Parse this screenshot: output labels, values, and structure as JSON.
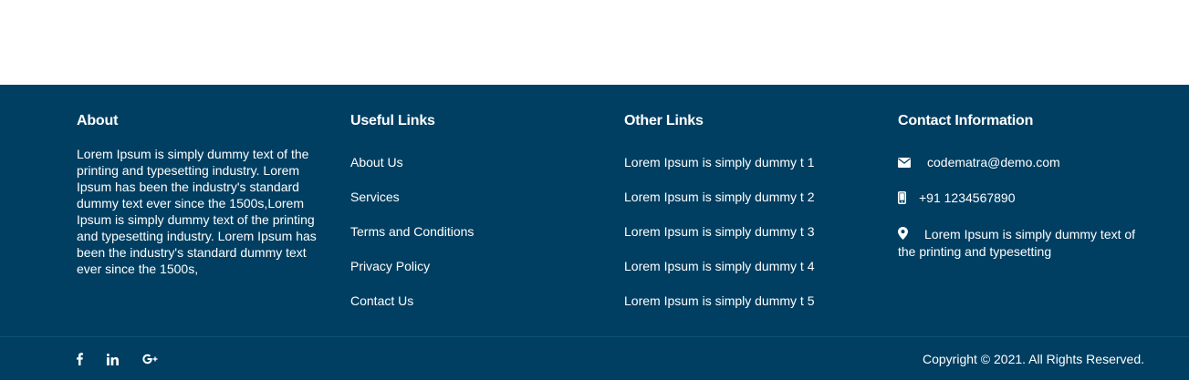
{
  "colors": {
    "footer_bg": "#003f62",
    "footer_text": "#ffffff",
    "divider": "#0f5374",
    "top_bg": "#ffffff"
  },
  "about": {
    "title": "About",
    "text": "Lorem Ipsum is simply dummy text of the printing and typesetting industry. Lorem Ipsum has been the industry's standard dummy text ever since the 1500s,Lorem Ipsum is simply dummy text of the printing and typesetting industry. Lorem Ipsum has been the industry's standard dummy text ever since the 1500s,"
  },
  "useful_links": {
    "title": "Useful Links",
    "items": [
      {
        "label": "About Us"
      },
      {
        "label": "Services"
      },
      {
        "label": "Terms and Conditions"
      },
      {
        "label": "Privacy Policy"
      },
      {
        "label": "Contact Us"
      }
    ]
  },
  "other_links": {
    "title": "Other Links",
    "items": [
      {
        "label": "Lorem Ipsum is simply dummy t 1"
      },
      {
        "label": "Lorem Ipsum is simply dummy t 2"
      },
      {
        "label": "Lorem Ipsum is simply dummy t 3"
      },
      {
        "label": "Lorem Ipsum is simply dummy t 4"
      },
      {
        "label": "Lorem Ipsum is simply dummy t 5"
      }
    ]
  },
  "contact": {
    "title": "Contact Information",
    "email": {
      "icon": "envelope-icon",
      "text": "codematra@demo.com"
    },
    "phone": {
      "icon": "mobile-phone-icon",
      "text": "+91 1234567890"
    },
    "address": {
      "icon": "map-marker-icon",
      "text": "Lorem Ipsum is simply dummy text of the printing and typesetting"
    }
  },
  "social": [
    {
      "name": "facebook",
      "icon": "facebook-icon"
    },
    {
      "name": "linkedin",
      "icon": "linkedin-icon"
    },
    {
      "name": "google-plus",
      "icon": "google-plus-icon"
    }
  ],
  "copyright": "Copyright © 2021. All Rights Reserved."
}
